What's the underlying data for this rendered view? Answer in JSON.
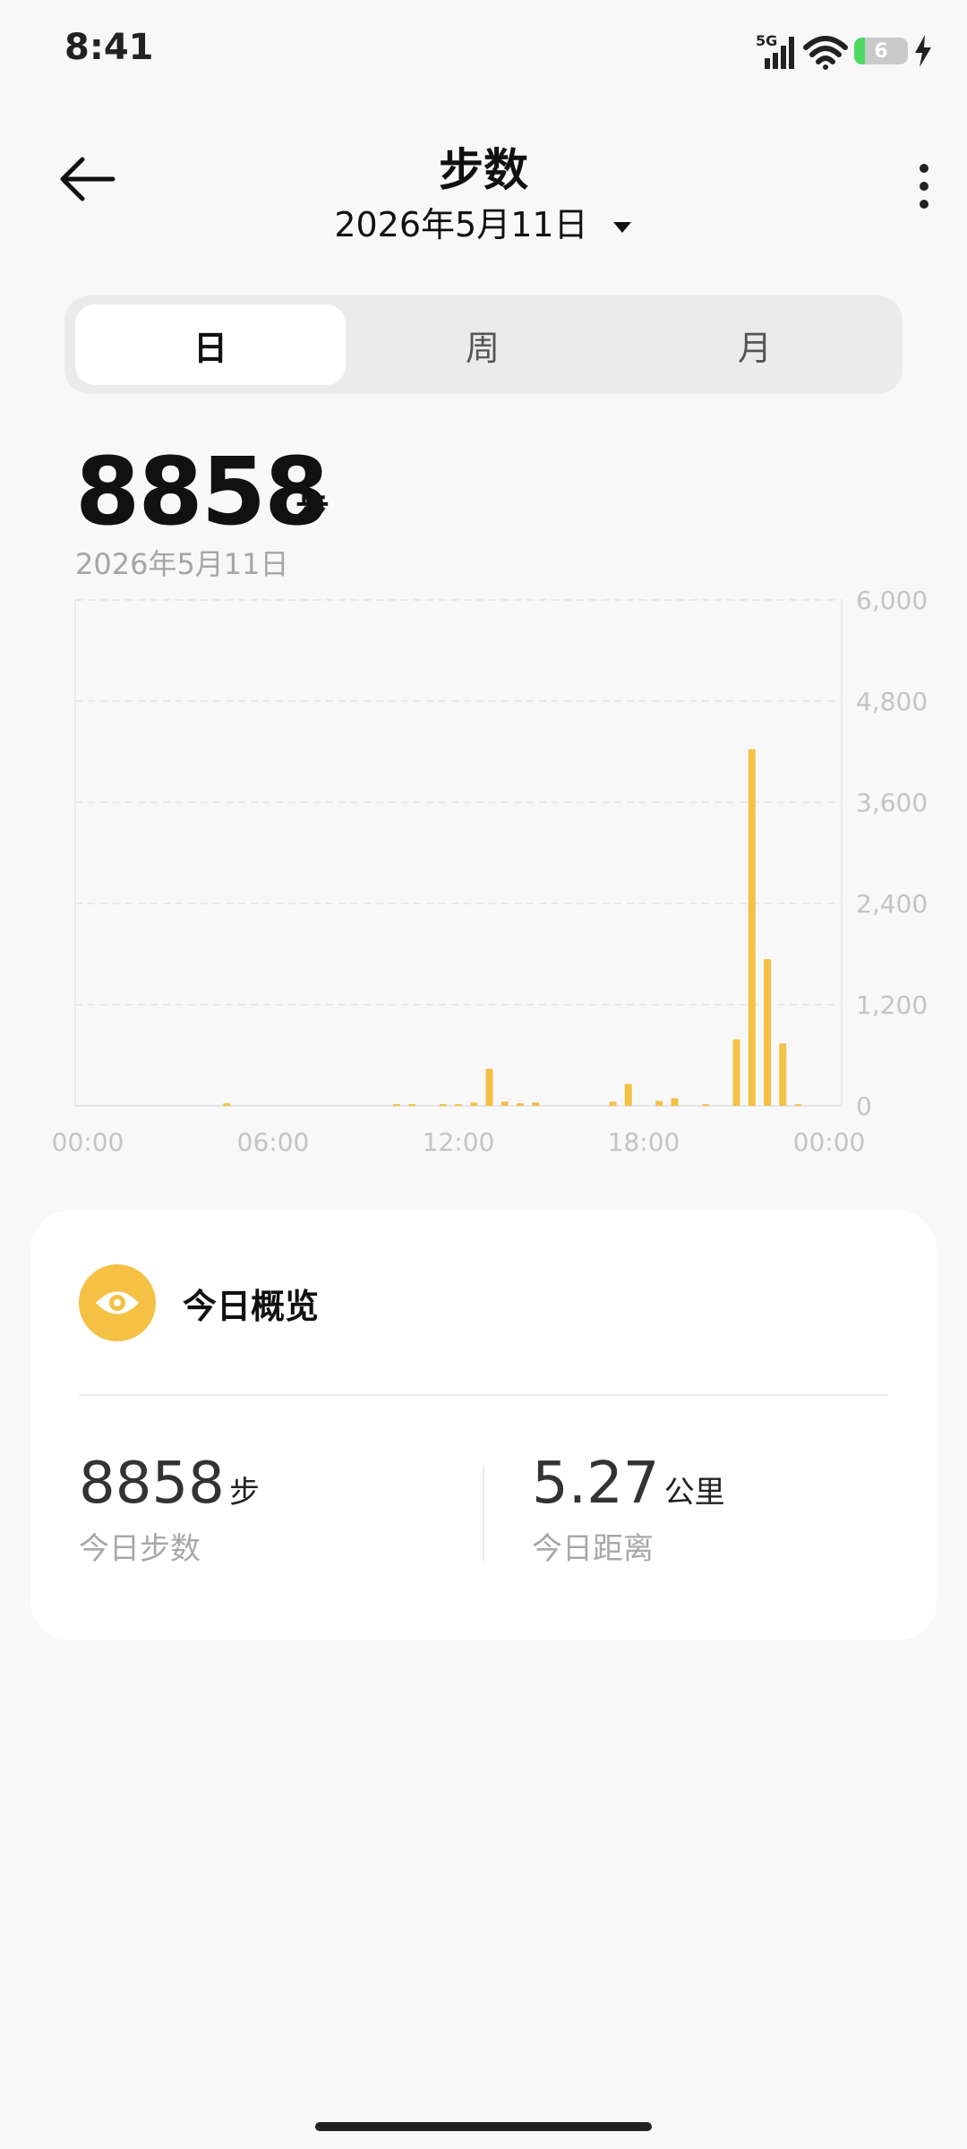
{
  "status_bar": {
    "time": "8:41",
    "network": "5G",
    "battery_level": "6"
  },
  "header": {
    "title": "步数",
    "date": "2026年5月11日"
  },
  "tabs": [
    {
      "label": "日",
      "active": true
    },
    {
      "label": "周",
      "active": false
    },
    {
      "label": "月",
      "active": false
    }
  ],
  "summary": {
    "value": "8858",
    "unit": "步",
    "date": "2026年5月11日"
  },
  "chart_data": {
    "type": "bar",
    "title": "",
    "xlabel": "",
    "ylabel": "",
    "x_tick_labels": [
      "00:00",
      "06:00",
      "12:00",
      "18:00",
      "00:00"
    ],
    "y_tick_labels": [
      "6,000",
      "4,800",
      "3,600",
      "2,400",
      "1,200",
      "0"
    ],
    "ylim": [
      0,
      6000
    ],
    "xlim_hours": [
      0,
      24
    ],
    "grid": true,
    "color": "#f4c145",
    "bins": [
      {
        "hour": 4.5,
        "steps": 30
      },
      {
        "hour": 10.0,
        "steps": 20
      },
      {
        "hour": 10.5,
        "steps": 20
      },
      {
        "hour": 11.5,
        "steps": 20
      },
      {
        "hour": 12.0,
        "steps": 20
      },
      {
        "hour": 12.5,
        "steps": 40
      },
      {
        "hour": 13.0,
        "steps": 440
      },
      {
        "hour": 13.5,
        "steps": 50
      },
      {
        "hour": 14.0,
        "steps": 30
      },
      {
        "hour": 14.5,
        "steps": 40
      },
      {
        "hour": 17.0,
        "steps": 50
      },
      {
        "hour": 17.5,
        "steps": 260
      },
      {
        "hour": 18.5,
        "steps": 60
      },
      {
        "hour": 19.0,
        "steps": 90
      },
      {
        "hour": 20.0,
        "steps": 20
      },
      {
        "hour": 21.0,
        "steps": 790
      },
      {
        "hour": 21.5,
        "steps": 4230
      },
      {
        "hour": 22.0,
        "steps": 1740
      },
      {
        "hour": 22.5,
        "steps": 740
      },
      {
        "hour": 23.0,
        "steps": 20
      }
    ]
  },
  "overview": {
    "title": "今日概览",
    "steps": {
      "value": "8858",
      "unit": "步",
      "label": "今日步数"
    },
    "distance": {
      "value": "5.27",
      "unit": "公里",
      "label": "今日距离"
    }
  }
}
